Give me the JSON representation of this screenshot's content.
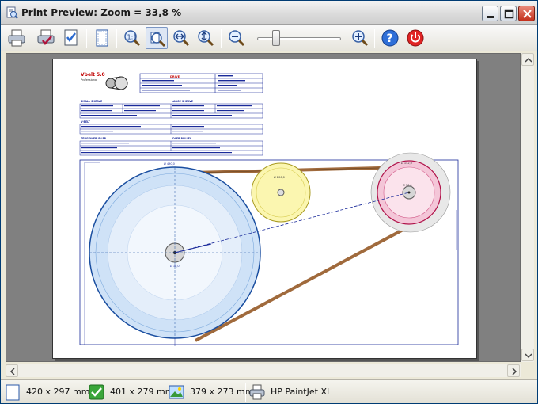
{
  "window": {
    "title": "Print Preview: Zoom = 33,8 %"
  },
  "toolbar": {
    "buttons": [
      {
        "name": "print-icon"
      },
      {
        "name": "print-setup-icon"
      },
      {
        "name": "print-options-icon"
      },
      {
        "name": "page-setup-icon"
      },
      {
        "name": "zoom-actual-size-icon"
      },
      {
        "name": "zoom-fit-page-icon"
      },
      {
        "name": "zoom-fit-width-icon"
      },
      {
        "name": "zoom-fit-height-icon"
      },
      {
        "name": "zoom-out-icon"
      },
      {
        "name": "zoom-in-icon"
      },
      {
        "name": "help-icon"
      },
      {
        "name": "close-preview-icon"
      }
    ],
    "zoom_slider_fraction": 0.2
  },
  "page": {
    "header_title": "Vbelt 5.0",
    "header_sub": "Professional",
    "drive_label": "DRIVE",
    "section_labels": {
      "small_sheave": "SMALL SHEAVE",
      "large_sheave": "LARGE SHEAVE",
      "v_belt": "V-BELT",
      "tensioner": "TENSIONER IDLER",
      "drive_pulley": "IDLER PULLEY"
    },
    "diagram_labels": {
      "large_pulley": "Ø 490,0",
      "idler_pulley": "Ø 206,0",
      "small_pulley": "Ø 142,0",
      "large_hub": "Ø 36,0",
      "small_hub": "Ø 36,0"
    }
  },
  "statusbar": {
    "paper_size": "420 x 297 mm",
    "print_area": "401 x 279 mm",
    "image_size": "379 x 273 mm",
    "printer": "HP PaintJet XL"
  },
  "colors": {
    "title_accent": "#d40000",
    "large_pulley_fill": "#cfe2f7",
    "idler_pulley_fill": "#fbf6b0",
    "small_pulley_fill": "#f4c6d8",
    "belt_color": "#a06a3c",
    "table_border": "#1a2a9a"
  }
}
